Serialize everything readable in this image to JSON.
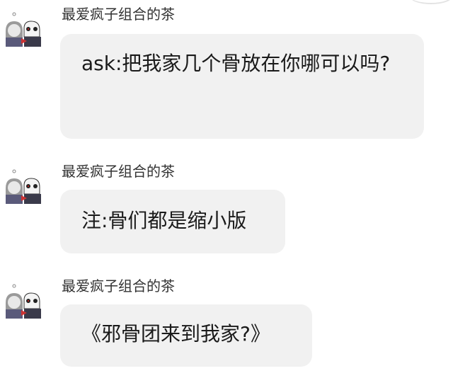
{
  "messages": [
    {
      "sender": "最爱疯子组合的茶",
      "text": "ask:把我家几个骨放在你哪可以吗?",
      "avatar_icon": "two-skeleton-characters-avatar"
    },
    {
      "sender": "最爱疯子组合的茶",
      "text": "注:骨们都是缩小版",
      "avatar_icon": "two-skeleton-characters-avatar"
    },
    {
      "sender": "最爱疯子组合的茶",
      "text": "《邪骨团来到我家?》",
      "avatar_icon": "two-skeleton-characters-avatar"
    }
  ],
  "colors": {
    "bubble_bg": "#f1f1f1",
    "sender_text": "#333333",
    "message_text": "#1a1a1a"
  }
}
